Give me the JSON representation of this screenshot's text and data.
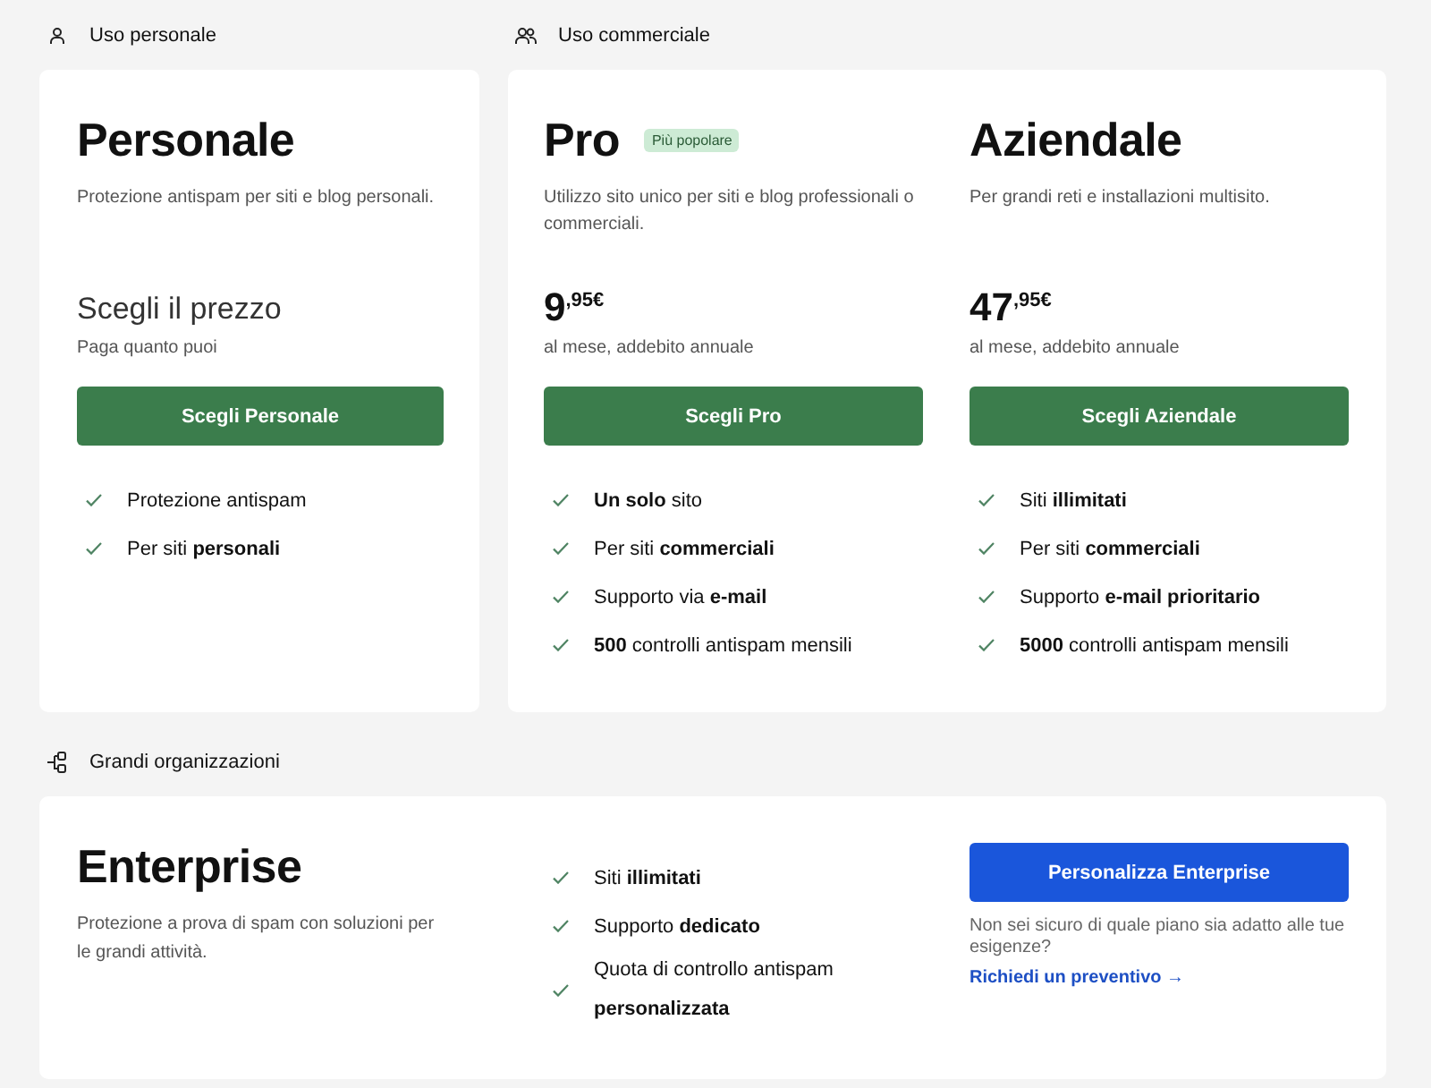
{
  "personal": {
    "heading": "Uso personale",
    "plans": [
      {
        "name": "Personale",
        "description": "Protezione antispam per siti e blog personali.",
        "price": {
          "kind": "custom",
          "text": "Scegli il prezzo",
          "caption": "Paga quanto puoi"
        },
        "button": "Scegli Personale",
        "features": [
          "Protezione antispam",
          "Per siti **personali**"
        ]
      }
    ]
  },
  "commercial": {
    "heading": "Uso commerciale",
    "plans": [
      {
        "name": "Pro",
        "badge": "Più popolare",
        "description": "Utilizzo sito unico per siti e blog professionali o commerciali.",
        "price": {
          "kind": "amount",
          "text": "9$^{,95€}$",
          "caption": "al mese, addebito annuale"
        },
        "button": "Scegli Pro",
        "features": [
          "**Un solo** sito",
          "Per siti **commerciali**",
          "Supporto via **e-mail**",
          "**500** controlli antispam mensili"
        ]
      },
      {
        "name": "Aziendale",
        "description": "Per grandi reti e installazioni multisito.",
        "price": {
          "kind": "amount",
          "text": "47$^{,95€}$",
          "caption": "al mese, addebito annuale"
        },
        "button": "Scegli Aziendale",
        "features": [
          "Siti **illimitati**",
          "Per siti **commerciali**",
          "Supporto **e-mail prioritario**",
          "**5000** controlli antispam mensili"
        ]
      }
    ]
  },
  "enterprise": {
    "heading": "Grandi organizzazioni",
    "name": "Enterprise",
    "description": "Protezione a prova di spam con soluzioni per le grandi attività.",
    "features": [
      "Siti **illimitati**",
      "Supporto **dedicato**",
      "Quota di controllo antispam **personalizzata**"
    ],
    "button": "Personalizza Enterprise",
    "note": "Non sei sicuro di quale piano sia adatto alle tue esigenze?",
    "link": "Richiedi un preventivo →"
  }
}
